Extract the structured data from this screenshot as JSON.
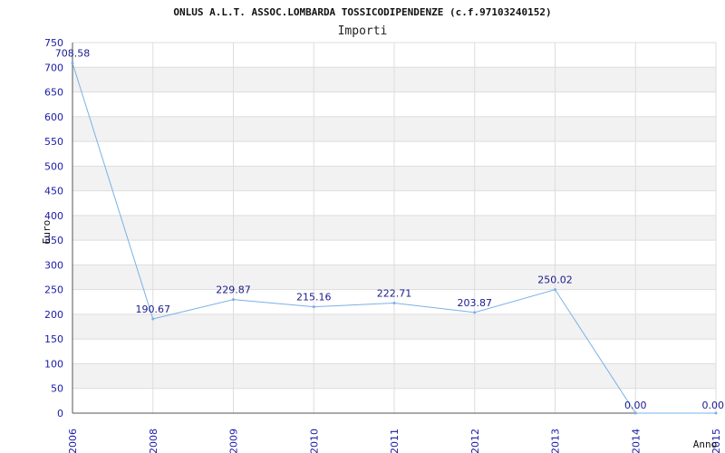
{
  "chart_data": {
    "type": "line",
    "title": "ONLUS A.L.T. ASSOC.LOMBARDA TOSSICODIPENDENZE (c.f.97103240152)",
    "subtitle": "Importi",
    "xlabel": "Anno",
    "ylabel": "Euro",
    "ylim": [
      0,
      750
    ],
    "yticks": [
      0,
      50,
      100,
      150,
      200,
      250,
      300,
      350,
      400,
      450,
      500,
      550,
      600,
      650,
      700,
      750
    ],
    "xticks": [
      "2006",
      "2008",
      "2009",
      "2010",
      "2011",
      "2012",
      "2013",
      "2014",
      "2015"
    ],
    "grid": true,
    "series": [
      {
        "color": "#7ab0e8",
        "points": [
          {
            "x": "2006",
            "y": 708.58,
            "label": "708.58"
          },
          {
            "x": "2008",
            "y": 190.67,
            "label": "190.67"
          },
          {
            "x": "2009",
            "y": 229.87,
            "label": "229.87"
          },
          {
            "x": "2010",
            "y": 215.16,
            "label": "215.16"
          },
          {
            "x": "2011",
            "y": 222.71,
            "label": "222.71"
          },
          {
            "x": "2012",
            "y": 203.87,
            "label": "203.87"
          },
          {
            "x": "2013",
            "y": 250.02,
            "label": "250.02"
          },
          {
            "x": "2014",
            "y": 0.0,
            "label": "0.00"
          },
          {
            "x": "2015",
            "y": 0.0,
            "label": "0.00"
          }
        ]
      }
    ]
  }
}
